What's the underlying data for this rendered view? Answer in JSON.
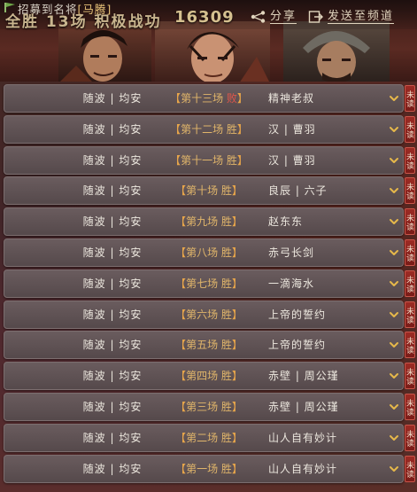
{
  "header": {
    "notice": {
      "prefix": "招募到名将",
      "name": "[马腾]"
    },
    "stats_label": "全胜 13场  积极战功",
    "stats_value": "16309",
    "share_label": "分享",
    "send_label": "发送至频道"
  },
  "matches": [
    {
      "team": "随波 | 均安",
      "open": "【",
      "round": "第十三场",
      "outcome": "败",
      "close": "】",
      "opponent": "精神老叔",
      "unread": "未读",
      "result": "lose"
    },
    {
      "team": "随波 | 均安",
      "open": "【",
      "round": "第十二场",
      "outcome": "胜",
      "close": "】",
      "opponent": "汉 | 曹羽",
      "unread": "未读",
      "result": "win"
    },
    {
      "team": "随波 | 均安",
      "open": "【",
      "round": "第十一场",
      "outcome": "胜",
      "close": "】",
      "opponent": "汉 | 曹羽",
      "unread": "未读",
      "result": "win"
    },
    {
      "team": "随波 | 均安",
      "open": "【",
      "round": "第十场",
      "outcome": "胜",
      "close": "】",
      "opponent": "良辰 | 六子",
      "unread": "未读",
      "result": "win"
    },
    {
      "team": "随波 | 均安",
      "open": "【",
      "round": "第九场",
      "outcome": "胜",
      "close": "】",
      "opponent": "赵东东",
      "unread": "未读",
      "result": "win"
    },
    {
      "team": "随波 | 均安",
      "open": "【",
      "round": "第八场",
      "outcome": "胜",
      "close": "】",
      "opponent": "赤弓长剑",
      "unread": "未读",
      "result": "win"
    },
    {
      "team": "随波 | 均安",
      "open": "【",
      "round": "第七场",
      "outcome": "胜",
      "close": "】",
      "opponent": "一滴海水",
      "unread": "未读",
      "result": "win"
    },
    {
      "team": "随波 | 均安",
      "open": "【",
      "round": "第六场",
      "outcome": "胜",
      "close": "】",
      "opponent": "上帝的誓约",
      "unread": "未读",
      "result": "win"
    },
    {
      "team": "随波 | 均安",
      "open": "【",
      "round": "第五场",
      "outcome": "胜",
      "close": "】",
      "opponent": "上帝的誓约",
      "unread": "未读",
      "result": "win"
    },
    {
      "team": "随波 | 均安",
      "open": "【",
      "round": "第四场",
      "outcome": "胜",
      "close": "】",
      "opponent": "赤壁 | 周公瑾",
      "unread": "未读",
      "result": "win"
    },
    {
      "team": "随波 | 均安",
      "open": "【",
      "round": "第三场",
      "outcome": "胜",
      "close": "】",
      "opponent": "赤壁 | 周公瑾",
      "unread": "未读",
      "result": "win"
    },
    {
      "team": "随波 | 均安",
      "open": "【",
      "round": "第二场",
      "outcome": "胜",
      "close": "】",
      "opponent": "山人自有妙计",
      "unread": "未读",
      "result": "win"
    },
    {
      "team": "随波 | 均安",
      "open": "【",
      "round": "第一场",
      "outcome": "胜",
      "close": "】",
      "opponent": "山人自有妙计",
      "unread": "未读",
      "result": "win"
    }
  ],
  "colors": {
    "win": "#e0b56a",
    "lose": "#e0564a",
    "bracket": "#e8a64a",
    "unread_bg": "#9c2b24"
  },
  "icons": {
    "share": "share-icon",
    "send": "send-to-channel-icon",
    "expand": "chevron-down-icon"
  }
}
